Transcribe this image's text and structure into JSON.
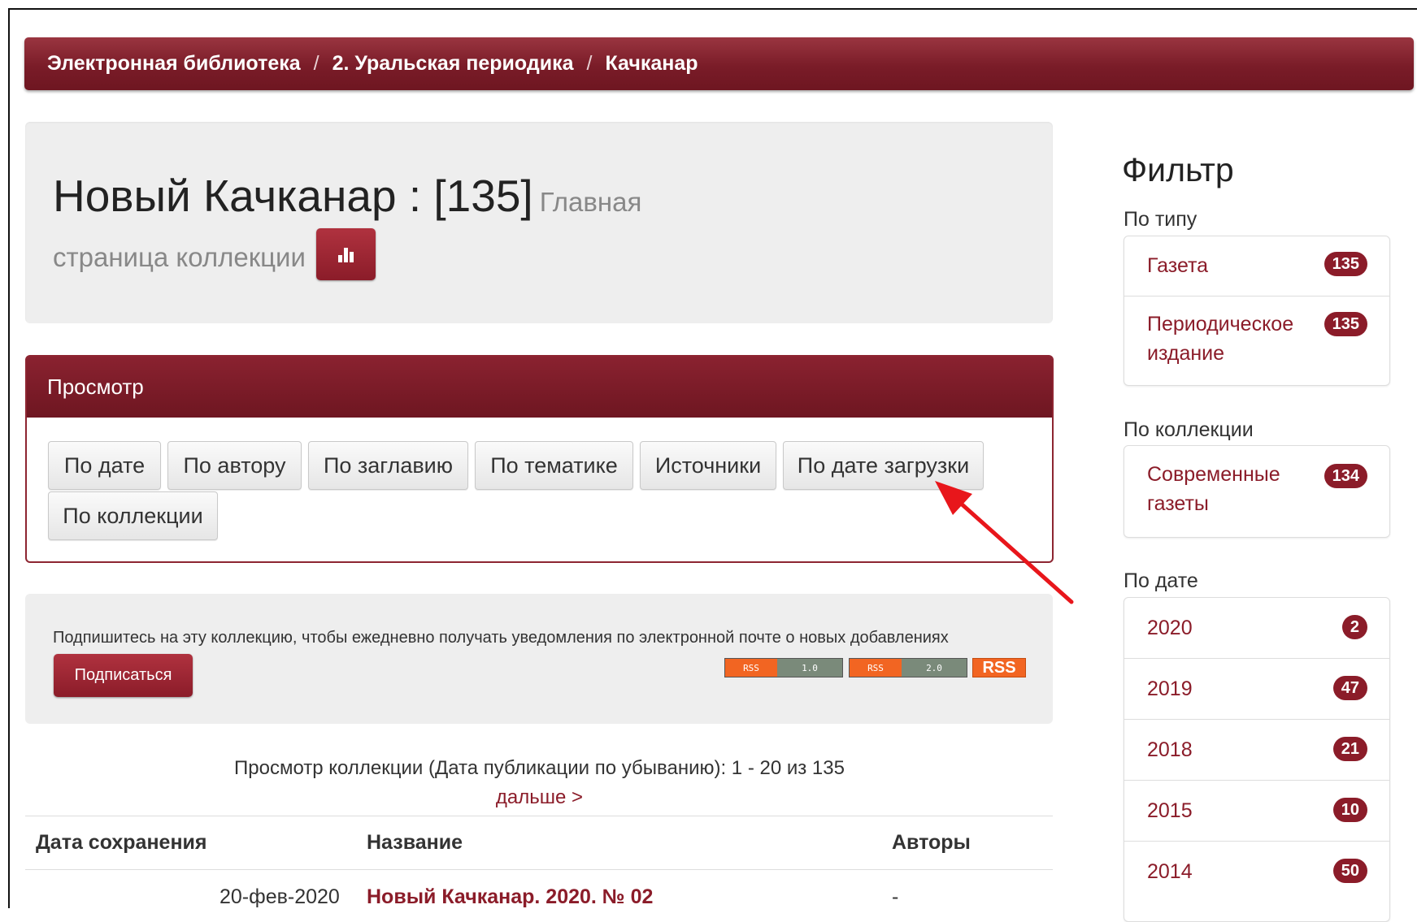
{
  "breadcrumb": {
    "items": [
      "Электронная библиотека",
      "2. Уральская периодика",
      "Качканар"
    ],
    "separator": "/"
  },
  "collection": {
    "title": "Новый Качканар : [135]",
    "subtitle_part1": "Главная",
    "subtitle_part2": "страница коллекции",
    "stats_icon": "bar-chart-icon"
  },
  "browse": {
    "heading": "Просмотр",
    "buttons": [
      "По дате",
      "По автору",
      "По заглавию",
      "По тематике",
      "Источники",
      "По дате загрузки",
      "По коллекции"
    ]
  },
  "subscribe": {
    "text": "Подпишитесь на эту коллекцию, чтобы ежедневно получать уведомления по электронной почте о новых добавлениях",
    "button": "Подписаться",
    "rss1_left": "RSS",
    "rss1_right": "1.0",
    "rss2_left": "RSS",
    "rss2_right": "2.0",
    "rss_big": "RSS"
  },
  "results": {
    "caption": "Просмотр коллекции (Дата публикации по убыванию): 1 - 20 из 135",
    "next": "дальше >",
    "columns": [
      "Дата сохранения",
      "Название",
      "Авторы"
    ],
    "rows": [
      {
        "date": "20-фев-2020",
        "title": "Новый Качканар. 2020. № 02",
        "authors": "-"
      }
    ]
  },
  "sidebar": {
    "title": "Фильтр",
    "by_type": {
      "heading": "По типу",
      "items": [
        {
          "label": "Газета",
          "count": "135"
        },
        {
          "label_line1": "Периодическое",
          "label_line2": "издание",
          "count": "135"
        }
      ]
    },
    "by_collection": {
      "heading": "По коллекции",
      "items": [
        {
          "label_line1": "Современные",
          "label_line2": "газеты",
          "count": "134"
        }
      ]
    },
    "by_date": {
      "heading": "По дате",
      "items": [
        {
          "label": "2020",
          "count": "2"
        },
        {
          "label": "2019",
          "count": "47"
        },
        {
          "label": "2018",
          "count": "21"
        },
        {
          "label": "2015",
          "count": "10"
        },
        {
          "label": "2014",
          "count": "50"
        }
      ]
    }
  },
  "colors": {
    "brand": "#8b1c29",
    "annotation_arrow": "#e8161b"
  }
}
